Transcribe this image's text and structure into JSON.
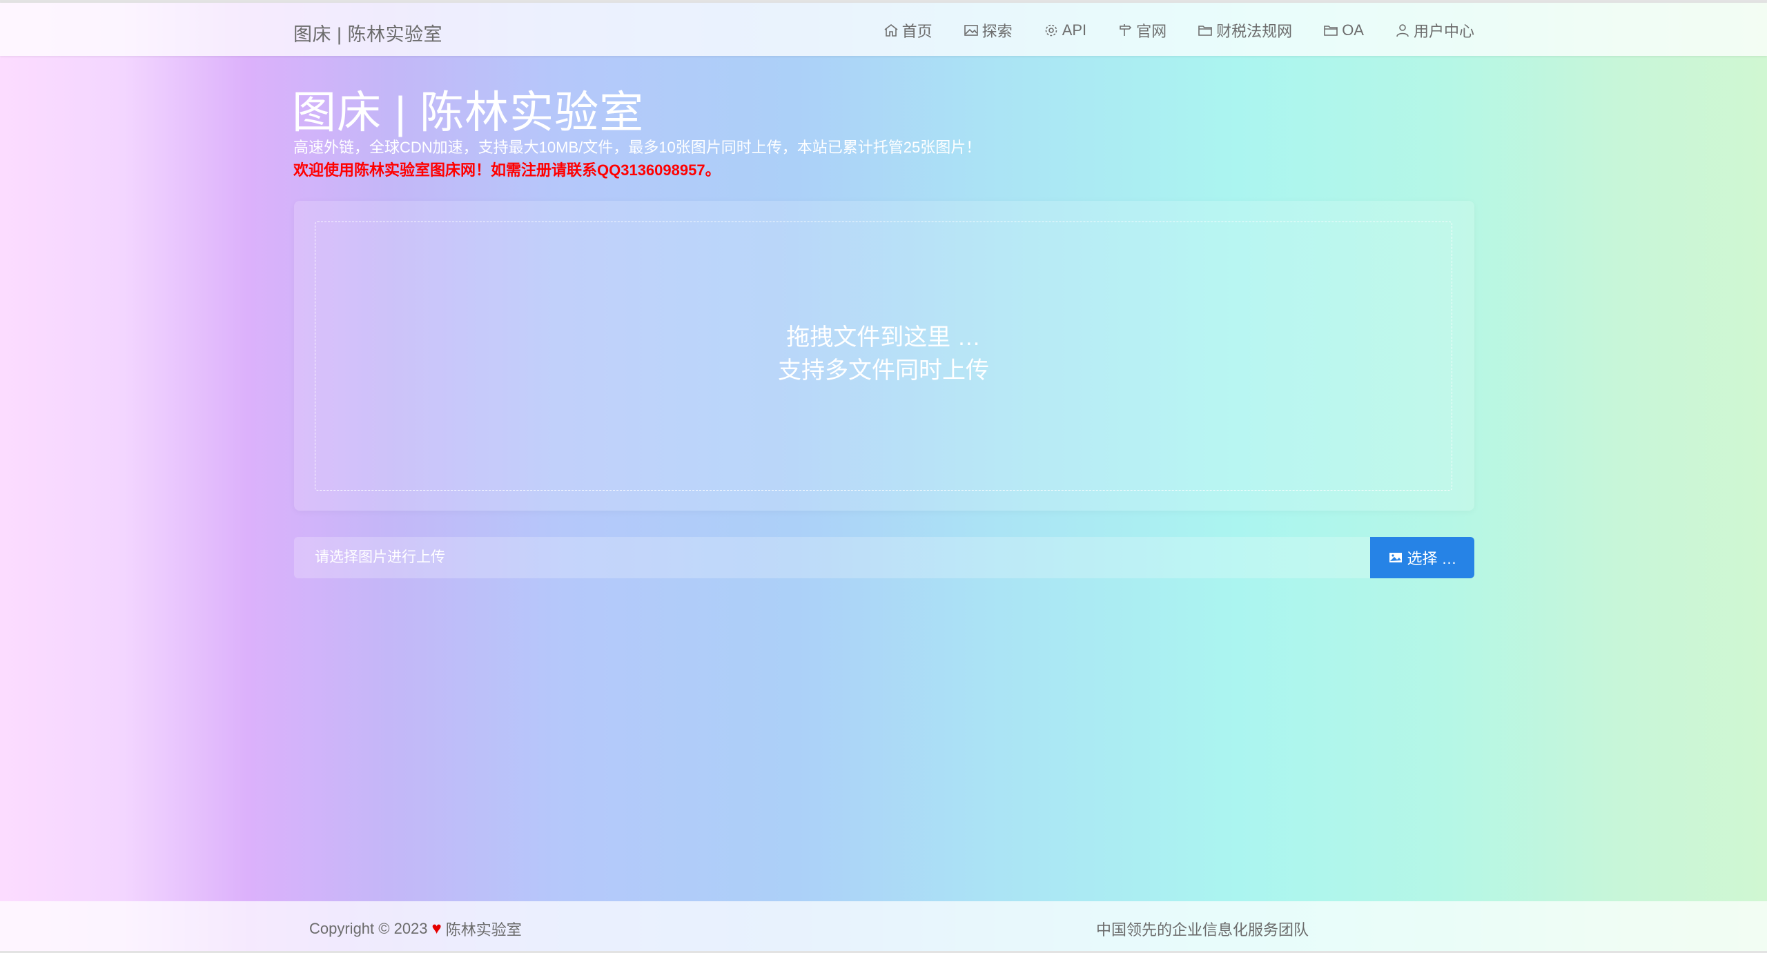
{
  "header": {
    "brand": "图床 | 陈林实验室",
    "nav": [
      {
        "label": "首页",
        "icon": "home-icon"
      },
      {
        "label": "探索",
        "icon": "image-icon"
      },
      {
        "label": "API",
        "icon": "gear-icon"
      },
      {
        "label": "官网",
        "icon": "signpost-icon"
      },
      {
        "label": "财税法规网",
        "icon": "folder-icon"
      },
      {
        "label": "OA",
        "icon": "folder-icon"
      },
      {
        "label": "用户中心",
        "icon": "user-icon"
      }
    ]
  },
  "hero": {
    "title": "图床 | 陈林实验室",
    "subtitle": "高速外链，全球CDN加速，支持最大10MB/文件，最多10张图片同时上传，本站已累计托管25张图片！",
    "notice": "欢迎使用陈林实验室图床网！如需注册请联系QQ3136098957。"
  },
  "upload": {
    "drop_line1": "拖拽文件到这里 …",
    "drop_line2": "支持多文件同时上传",
    "placeholder": "请选择图片进行上传",
    "choose_label": "选择 …"
  },
  "footer": {
    "copyright": "Copyright © 2023",
    "owner": "陈林实验室",
    "slogan": "中国领先的企业信息化服务团队"
  },
  "colors": {
    "accent": "#2683e6",
    "notice": "#ff0000",
    "heart": "#e60000"
  }
}
